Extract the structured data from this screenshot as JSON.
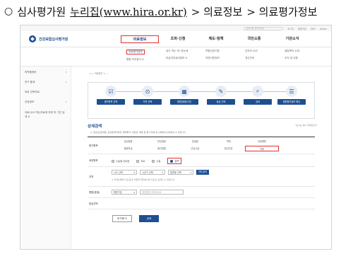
{
  "heading": {
    "bullet": "○",
    "prefix": "심사평가원",
    "site_link": "누리집(www.hira.or.kr)",
    "crumb_1": "> 의료정보",
    "crumb_2": "> 의료평가정보"
  },
  "utility": {
    "search_placeholder": "검색어를 입력하세요",
    "links": [
      "로그인",
      "회원가입",
      "ENG",
      "Global"
    ]
  },
  "logo": {
    "name": "건강보험심사평가원"
  },
  "gnb": {
    "menus": [
      "의료정보",
      "조회·신청",
      "제도·정책",
      "국민소통",
      "기관소식"
    ],
    "active_index": 0
  },
  "subnav": {
    "col1": [
      "의료평가정보",
      "병원·약국찾기 ⊘"
    ],
    "col2": [
      "내가 먹는 약! 한눈에",
      "비급여진료비정보 ⊘"
    ],
    "col3": [
      "보험인정기준",
      "약제기준정보"
    ],
    "col4": [
      "건의의 소리",
      "개선건의"
    ],
    "col5": [
      "설립목적 소개",
      "조직 및 인원"
    ]
  },
  "sidebar": {
    "items": [
      {
        "label": "의약품정보",
        "chev": "∨"
      },
      {
        "label": "연구·통계",
        "chev": "∨"
      },
      {
        "label": "의료 인력자료",
        "chev": ""
      },
      {
        "label": "건강정보",
        "chev": "∨"
      },
      {
        "label": "코로나19 먹는치료제 처방 의 기관 검색 ⊘",
        "chev": ""
      }
    ]
  },
  "crumb": "⌂ > 의료평가 > ...",
  "steps": [
    {
      "label": "평가항목 선택",
      "icon": "☑"
    },
    {
      "label": "지역 선택",
      "icon": "⊙"
    },
    {
      "label": "병원(종합)구분",
      "icon": "▦"
    },
    {
      "label": "등급 선택",
      "icon": "✎"
    },
    {
      "label": "검색",
      "icon": "⌕"
    },
    {
      "label": "병원평가정보 확인",
      "icon": "☰"
    }
  ],
  "detail": {
    "title": "상세검색",
    "required_note": "*표시는 필수 항목입니다",
    "notice": "◎ 급성심근경색증, 관상동맥우회술, 혈액투석, 대장암, 폐암 등 평가 항목 중 선택하여 검색하실 수 있습니다."
  },
  "rows": {
    "eval_label": "평가항목",
    "eval_items": [
      "급성질환",
      "만성질환",
      "암질환",
      "약제",
      "요양병원",
      "중환자실",
      "환자경험",
      "난임시술",
      "정신건강",
      "기타"
    ],
    "eval_highlight_index": 9,
    "care_label": "세부항목",
    "care_options": [
      "수술별 진료량",
      "의료",
      "수질",
      "결핵"
    ],
    "care_selected_index": 3,
    "region_label": "지역",
    "region_selects": [
      "시도 선택",
      "시군구 선택",
      "읍면동 선택"
    ],
    "region_button": "지도검색",
    "region_hint": "※ 지역선택에 '지도검색' 버튼을 클릭하시면 지도로 검색할 수 있습니다.",
    "hospital_label": "병원(종별)",
    "hospital_select": "병원구분",
    "hospital_input_placeholder": "병원명을 입력하세요",
    "grade_label": "등급선택"
  },
  "actions": {
    "reset": "초기화 ↻",
    "search": "검색"
  },
  "colors": {
    "accent": "#1d4f91",
    "highlight": "#e03131"
  }
}
